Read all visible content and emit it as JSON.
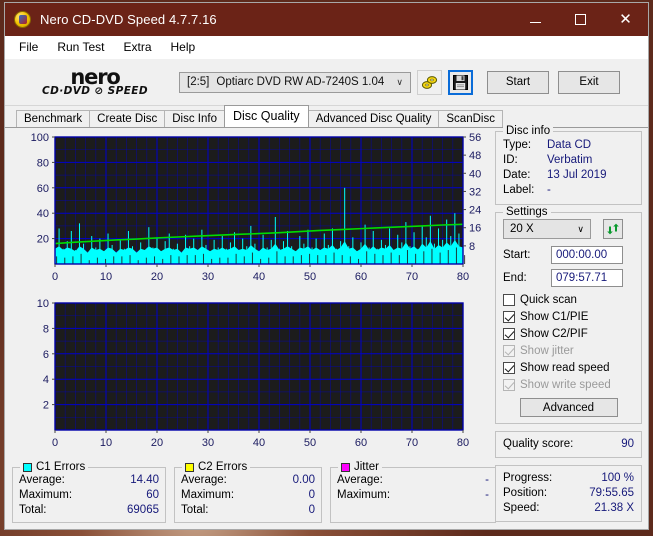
{
  "window": {
    "title": "Nero CD-DVD Speed 4.7.7.16",
    "app_icon": "nero-disc-icon",
    "minimize_label": "─",
    "maximize_label": "",
    "close_label": "✕",
    "titlebar_color": "#6b2317"
  },
  "menu": {
    "items": [
      {
        "label": "File"
      },
      {
        "label": "Run Test"
      },
      {
        "label": "Extra"
      },
      {
        "label": "Help"
      }
    ]
  },
  "toolbar": {
    "logo_word": "nero",
    "logo_sub": "CD·DVD ⊘ SPEED",
    "drive": {
      "id": "[2:5]",
      "name": "Optiarc DVD RW AD-7240S 1.04",
      "chevron": "∨"
    },
    "icons": [
      {
        "name": "disc-tools-icon"
      },
      {
        "name": "save-icon"
      }
    ],
    "start_label": "Start",
    "exit_label": "Exit"
  },
  "tabs": [
    {
      "label": "Benchmark",
      "active": false
    },
    {
      "label": "Create Disc",
      "active": false
    },
    {
      "label": "Disc Info",
      "active": false
    },
    {
      "label": "Disc Quality",
      "active": true
    },
    {
      "label": "Advanced Disc Quality",
      "active": false
    },
    {
      "label": "ScanDisc",
      "active": false
    }
  ],
  "disc_info": {
    "title": "Disc info",
    "rows": [
      {
        "key": "Type:",
        "value": "Data CD"
      },
      {
        "key": "ID:",
        "value": "Verbatim"
      },
      {
        "key": "Date:",
        "value": "13 Jul 2019"
      },
      {
        "key": "Label:",
        "value": "-"
      }
    ]
  },
  "settings": {
    "title": "Settings",
    "speed_value": "20 X",
    "speed_chevron": "∨",
    "refresh_icon": "refresh-icon",
    "start_label": "Start:",
    "start_value": "000:00.00",
    "end_label": "End:",
    "end_value": "079:57.71",
    "checkboxes": [
      {
        "label": "Quick scan",
        "checked": false,
        "enabled": true
      },
      {
        "label": "Show C1/PIE",
        "checked": true,
        "enabled": true
      },
      {
        "label": "Show C2/PIF",
        "checked": true,
        "enabled": true
      },
      {
        "label": "Show jitter",
        "checked": true,
        "enabled": false
      },
      {
        "label": "Show read speed",
        "checked": true,
        "enabled": true
      },
      {
        "label": "Show write speed",
        "checked": true,
        "enabled": false
      }
    ],
    "advanced_label": "Advanced"
  },
  "quality": {
    "label": "Quality score:",
    "value": "90"
  },
  "progress": {
    "rows": [
      {
        "key": "Progress:",
        "value": "100 %"
      },
      {
        "key": "Position:",
        "value": "79:55.65"
      },
      {
        "key": "Speed:",
        "value": "21.38 X"
      }
    ]
  },
  "stats": {
    "c1": {
      "title": "C1 Errors",
      "color": "#00ffff",
      "rows": [
        {
          "key": "Average:",
          "value": "14.40"
        },
        {
          "key": "Maximum:",
          "value": "60"
        },
        {
          "key": "Total:",
          "value": "69065"
        }
      ]
    },
    "c2": {
      "title": "C2 Errors",
      "color": "#ffff00",
      "rows": [
        {
          "key": "Average:",
          "value": "0.00"
        },
        {
          "key": "Maximum:",
          "value": "0"
        },
        {
          "key": "Total:",
          "value": "0"
        }
      ]
    },
    "jitter": {
      "title": "Jitter",
      "color": "#ff00ff",
      "rows": [
        {
          "key": "Average:",
          "value": "-"
        },
        {
          "key": "Maximum:",
          "value": "-"
        }
      ]
    }
  },
  "chart_data": [
    {
      "type": "area",
      "name": "c1-error-chart",
      "title": "",
      "xlabel": "",
      "ylabel": "",
      "xlim": [
        0,
        80
      ],
      "ylim": [
        0,
        100
      ],
      "xticks": [
        0,
        10,
        20,
        30,
        40,
        50,
        60,
        70,
        80
      ],
      "yticks": [
        20,
        40,
        60,
        80,
        100
      ],
      "y2lim": [
        0,
        56
      ],
      "y2ticks": [
        8,
        16,
        24,
        32,
        40,
        48,
        56
      ],
      "grid": true,
      "plot_bg": "#1c1c1c",
      "grid_color": "#0000cc",
      "series": [
        {
          "name": "C1 Errors",
          "color": "#00ffff",
          "kind": "area",
          "x": [
            0,
            0.8,
            1.6,
            2.4,
            3.2,
            4,
            4.8,
            5.6,
            6.4,
            7.2,
            8,
            8.8,
            9.6,
            10.4,
            11.2,
            12,
            12.8,
            13.6,
            14.4,
            15.2,
            16,
            16.8,
            17.6,
            18.4,
            19.2,
            20,
            20.8,
            21.6,
            22.4,
            23.2,
            24,
            24.8,
            25.6,
            26.4,
            27.2,
            28,
            28.8,
            29.6,
            30.4,
            31.2,
            32,
            32.8,
            33.6,
            34.4,
            35.2,
            36,
            36.8,
            37.6,
            38.4,
            39.2,
            40,
            40.8,
            41.6,
            42.4,
            43.2,
            44,
            44.8,
            45.6,
            46.4,
            47.2,
            48,
            48.8,
            49.6,
            50.4,
            51.2,
            52,
            52.8,
            53.6,
            54.4,
            55.2,
            56,
            56.8,
            57.6,
            58.4,
            59.2,
            60,
            60.8,
            61.6,
            62.4,
            63.2,
            64,
            64.8,
            65.6,
            66.4,
            67.2,
            68,
            68.8,
            69.6,
            70.4,
            71.2,
            72,
            72.8,
            73.6,
            74.4,
            75.2,
            76,
            76.8,
            77.6,
            78.4,
            79.2,
            80
          ],
          "values": [
            14,
            28,
            12,
            18,
            26,
            11,
            32,
            16,
            9,
            22,
            13,
            20,
            10,
            24,
            15,
            8,
            19,
            12,
            26,
            14,
            9,
            17,
            11,
            29,
            13,
            21,
            10,
            18,
            24,
            12,
            16,
            9,
            23,
            14,
            20,
            11,
            27,
            15,
            10,
            19,
            13,
            22,
            12,
            17,
            25,
            11,
            20,
            14,
            30,
            16,
            9,
            23,
            13,
            19,
            37,
            12,
            18,
            26,
            14,
            10,
            22,
            16,
            27,
            13,
            20,
            11,
            24,
            15,
            28,
            12,
            18,
            60,
            14,
            21,
            10,
            17,
            31,
            13,
            26,
            12,
            19,
            15,
            28,
            11,
            23,
            17,
            33,
            14,
            25,
            12,
            30,
            21,
            38,
            16,
            28,
            19,
            35,
            22,
            40,
            24,
            21
          ],
          "baseline": [
            12,
            14,
            11,
            13,
            12,
            10,
            14,
            12,
            9,
            13,
            11,
            12,
            10,
            13,
            12,
            9,
            12,
            11,
            13,
            12,
            9,
            12,
            11,
            14,
            12,
            13,
            10,
            12,
            13,
            11,
            12,
            9,
            13,
            12,
            13,
            11,
            14,
            12,
            10,
            12,
            11,
            13,
            11,
            12,
            14,
            11,
            12,
            11,
            15,
            12,
            10,
            13,
            11,
            12,
            16,
            11,
            12,
            14,
            12,
            10,
            13,
            12,
            14,
            11,
            13,
            11,
            13,
            12,
            15,
            11,
            13,
            18,
            12,
            13,
            10,
            12,
            16,
            11,
            14,
            11,
            13,
            12,
            15,
            11,
            13,
            12,
            17,
            12,
            14,
            11,
            16,
            13,
            18,
            12,
            15,
            13,
            17,
            14,
            19,
            14,
            13
          ]
        },
        {
          "name": "Read speed",
          "color": "#00dd00",
          "kind": "line",
          "axis": "right",
          "x": [
            0,
            4,
            8,
            12,
            16,
            20,
            24,
            28,
            32,
            36,
            40,
            44,
            48,
            52,
            56,
            60,
            64,
            68,
            72,
            76,
            80
          ],
          "values": [
            9.0,
            9.6,
            10.1,
            10.6,
            11.0,
            11.5,
            11.9,
            12.3,
            12.7,
            13.1,
            13.4,
            13.8,
            14.3,
            14.8,
            15.2,
            15.6,
            16.0,
            16.4,
            16.8,
            17.2,
            17.5
          ]
        }
      ]
    },
    {
      "type": "area",
      "name": "c2-error-chart",
      "title": "",
      "xlabel": "",
      "ylabel": "",
      "xlim": [
        0,
        80
      ],
      "ylim": [
        0,
        10
      ],
      "xticks": [
        0,
        10,
        20,
        30,
        40,
        50,
        60,
        70,
        80
      ],
      "yticks": [
        2,
        4,
        6,
        8,
        10
      ],
      "grid": true,
      "plot_bg": "#1c1c1c",
      "grid_color": "#0000cc",
      "series": [
        {
          "name": "C2 Errors",
          "color": "#ffff00",
          "kind": "area",
          "x": [],
          "values": []
        }
      ]
    }
  ]
}
